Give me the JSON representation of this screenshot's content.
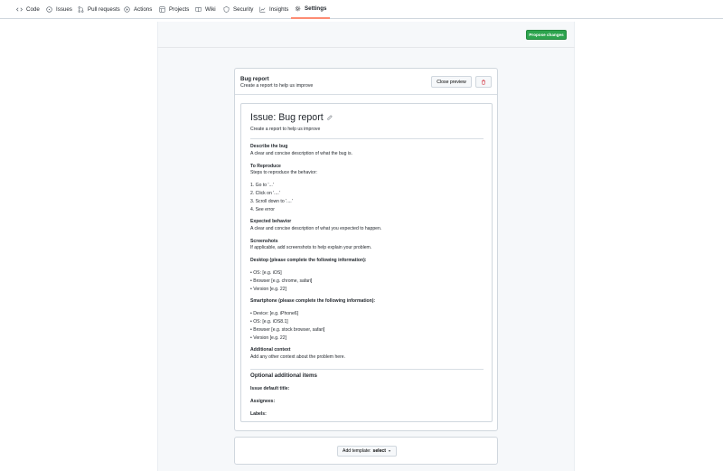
{
  "nav": {
    "items": [
      {
        "label": "Code",
        "icon": "code-icon"
      },
      {
        "label": "Issues",
        "icon": "issue-icon"
      },
      {
        "label": "Pull requests",
        "icon": "pull-request-icon"
      },
      {
        "label": "Actions",
        "icon": "play-icon"
      },
      {
        "label": "Projects",
        "icon": "table-icon"
      },
      {
        "label": "Wiki",
        "icon": "book-icon"
      },
      {
        "label": "Security",
        "icon": "shield-icon"
      },
      {
        "label": "Insights",
        "icon": "graph-icon"
      },
      {
        "label": "Settings",
        "icon": "gear-icon"
      }
    ],
    "active": "Settings",
    "accent": "#fd8c73"
  },
  "toolbar": {
    "propose_label": "Propose changes",
    "propose_color": "#2da44e"
  },
  "template": {
    "name": "Bug report",
    "about": "Create a report to help us improve",
    "close_preview_label": "Close preview",
    "delete_icon": "trash-icon"
  },
  "preview": {
    "title": "Issue: Bug report",
    "subtitle": "Create a report to help us improve",
    "body": {
      "describe_heading": "Describe the bug",
      "describe_text": "A clear and concise description of what the bug is.",
      "reproduce_heading": "To Reproduce",
      "reproduce_text": "Steps to reproduce the behavior:",
      "steps": [
        "1. Go to '...'",
        "2. Click on '....'",
        "3. Scroll down to '....'",
        "4. See error"
      ],
      "expected_heading": "Expected behavior",
      "expected_text": "A clear and concise description of what you expected to happen.",
      "screenshots_heading": "Screenshots",
      "screenshots_text": "If applicable, add screenshots to help explain your problem.",
      "desktop_heading": "Desktop (please complete the following information):",
      "desktop_items": [
        "OS: [e.g. iOS]",
        "Browser [e.g. chrome, safari]",
        "Version [e.g. 22]"
      ],
      "smartphone_heading": "Smartphone (please complete the following information):",
      "smartphone_items": [
        "Device: [e.g. iPhone6]",
        "OS: [e.g. iOS8.1]",
        "Browser [e.g. stock browser, safari]",
        "Version [e.g. 22]"
      ],
      "context_heading": "Additional context",
      "context_text": "Add any other context about the problem here."
    },
    "optional": {
      "title": "Optional additional items",
      "default_title_label": "Issue default title:",
      "assignees_label": "Assignees:",
      "labels_label": "Labels:"
    }
  },
  "add_template": {
    "label": "Add template:",
    "value": "select"
  }
}
